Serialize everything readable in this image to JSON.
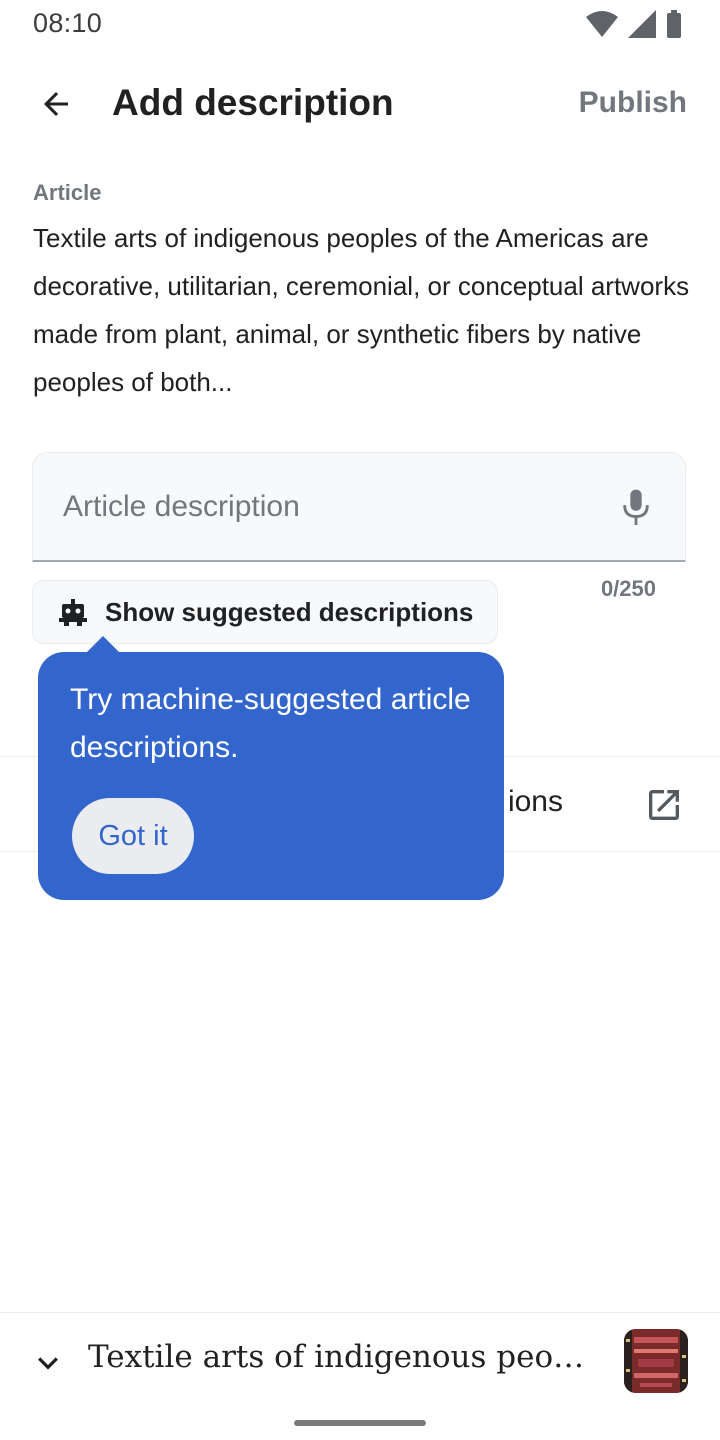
{
  "status_bar": {
    "time": "08:10"
  },
  "app_bar": {
    "title": "Add description",
    "publish_label": "Publish"
  },
  "article": {
    "label": "Article",
    "extract": "Textile arts of indigenous peoples of the Americas are decorative, utilitarian, ceremonial, or conceptual artworks made from plant, animal, or synthetic fibers by native peoples of both..."
  },
  "description_field": {
    "placeholder": "Article description",
    "value": "",
    "counter": "0/250"
  },
  "suggest_chip": {
    "label": "Show suggested descriptions"
  },
  "hidden_row": {
    "visible_text_fragment": "ions"
  },
  "tooltip": {
    "text": "Try machine-suggested article descriptions.",
    "button_label": "Got it"
  },
  "bottom_bar": {
    "article_title": "Textile arts of indigenous peopl..."
  },
  "colors": {
    "accent": "#3366cc",
    "text": "#202122",
    "muted": "#72777d",
    "field_bg": "#f8f9fa"
  }
}
